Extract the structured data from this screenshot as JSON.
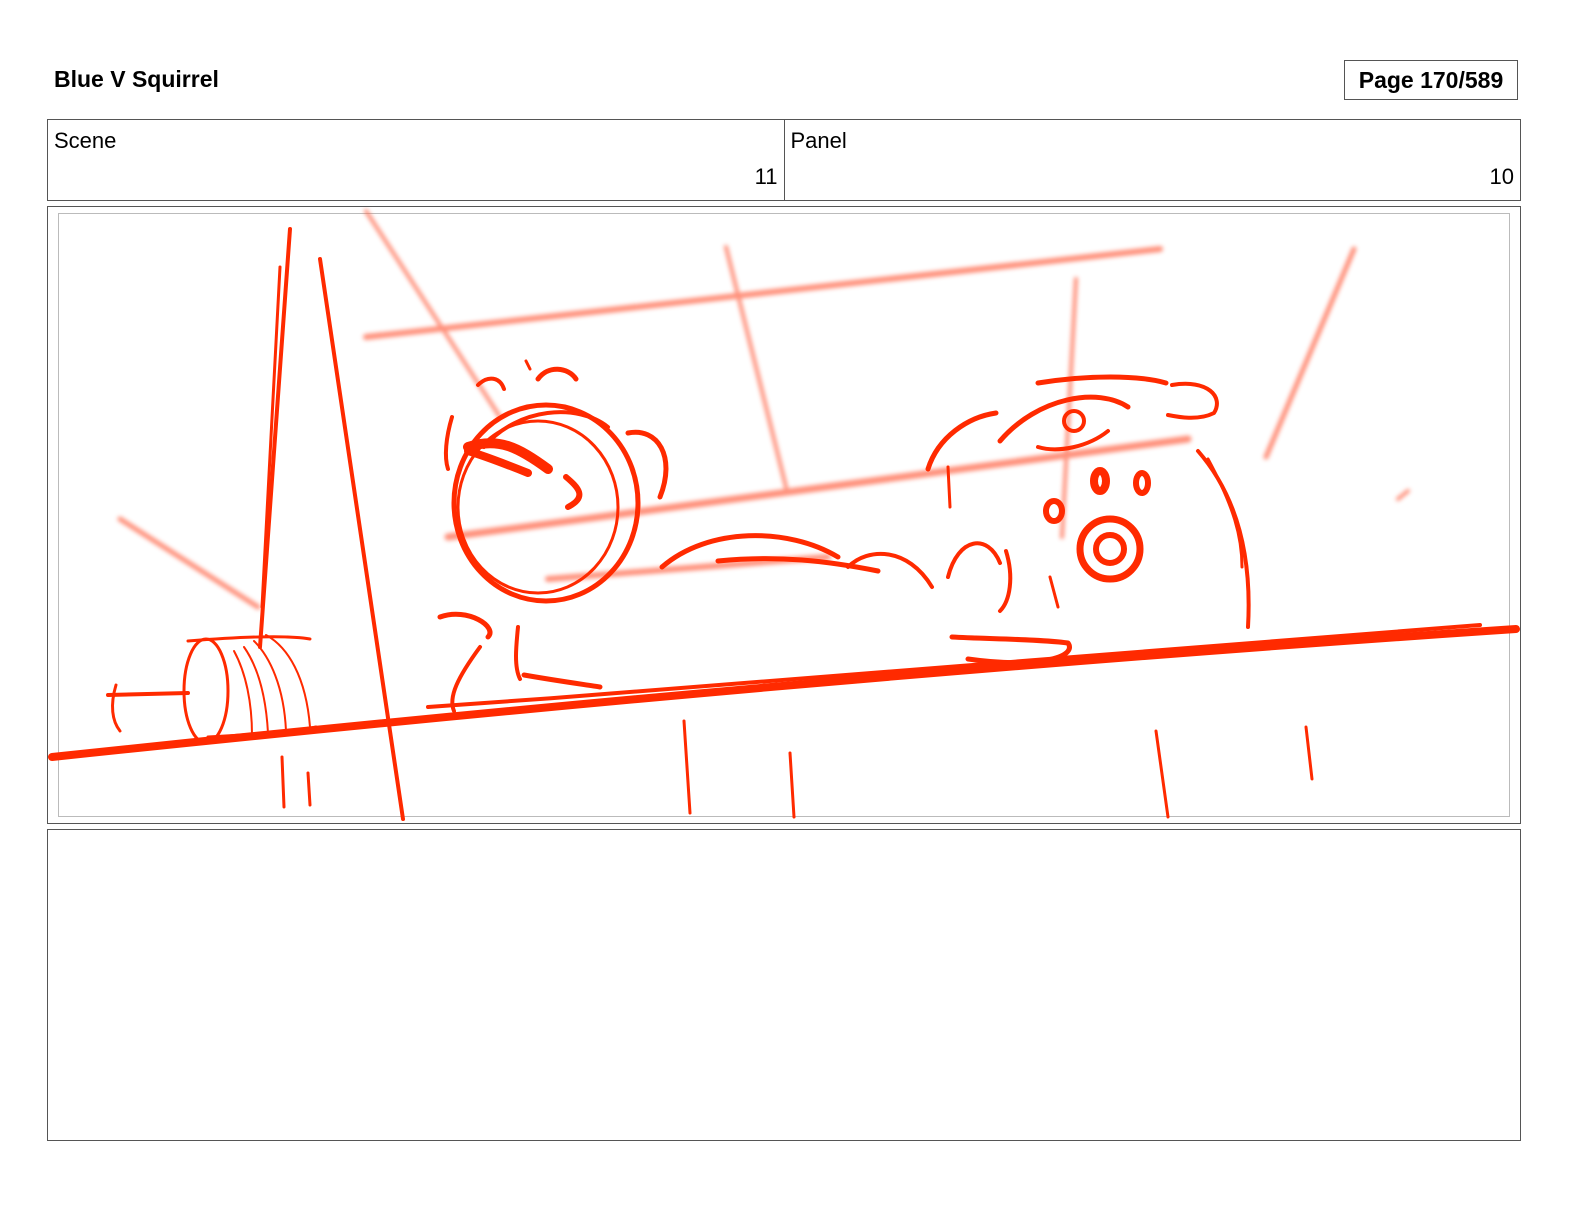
{
  "header": {
    "title": "Blue V Squirrel",
    "page_label": "Page 170/589"
  },
  "info": {
    "scene_label": "Scene",
    "scene_value": "11",
    "panel_label": "Panel",
    "panel_value": "10"
  },
  "sketch": {
    "stroke_color": "#ff2a00",
    "guide_color": "#ff6a4d"
  },
  "notes": {
    "text": ""
  }
}
